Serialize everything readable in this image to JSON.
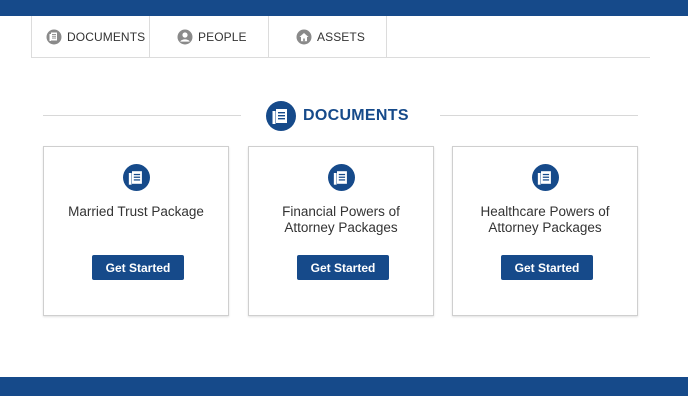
{
  "colors": {
    "brand": "#164a8a",
    "border": "#cfcfcf",
    "text": "#333333"
  },
  "tabs": [
    {
      "label": "DOCUMENTS",
      "icon": "document-icon"
    },
    {
      "label": "PEOPLE",
      "icon": "people-icon"
    },
    {
      "label": "ASSETS",
      "icon": "assets-icon"
    }
  ],
  "section": {
    "title": "DOCUMENTS",
    "icon": "document-icon"
  },
  "cards": [
    {
      "title": "Married Trust Package",
      "button": "Get Started",
      "icon": "document-icon"
    },
    {
      "title": "Financial Powers of Attorney Packages",
      "button": "Get Started",
      "icon": "document-icon"
    },
    {
      "title": "Healthcare Powers of Attorney Packages",
      "button": "Get Started",
      "icon": "document-icon"
    }
  ]
}
